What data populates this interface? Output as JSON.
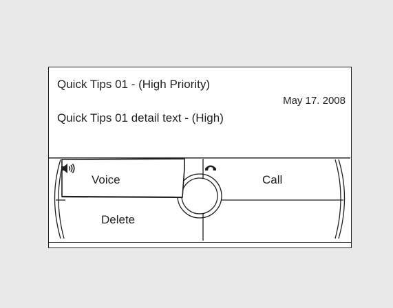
{
  "message": {
    "title": "Quick Tips 01 - (High Priority)",
    "date": "May 17. 2008",
    "detail": "Quick Tips 01 detail text - (High)"
  },
  "softkeys": {
    "voice": {
      "label": "Voice",
      "icon": "speaker-icon",
      "selected": true
    },
    "call": {
      "label": "Call",
      "icon": "phone-handset-icon"
    },
    "delete": {
      "label": "Delete"
    }
  },
  "colors": {
    "background": "#e9e9e9",
    "screen": "#ffffff",
    "ink": "#1e1e1e"
  }
}
